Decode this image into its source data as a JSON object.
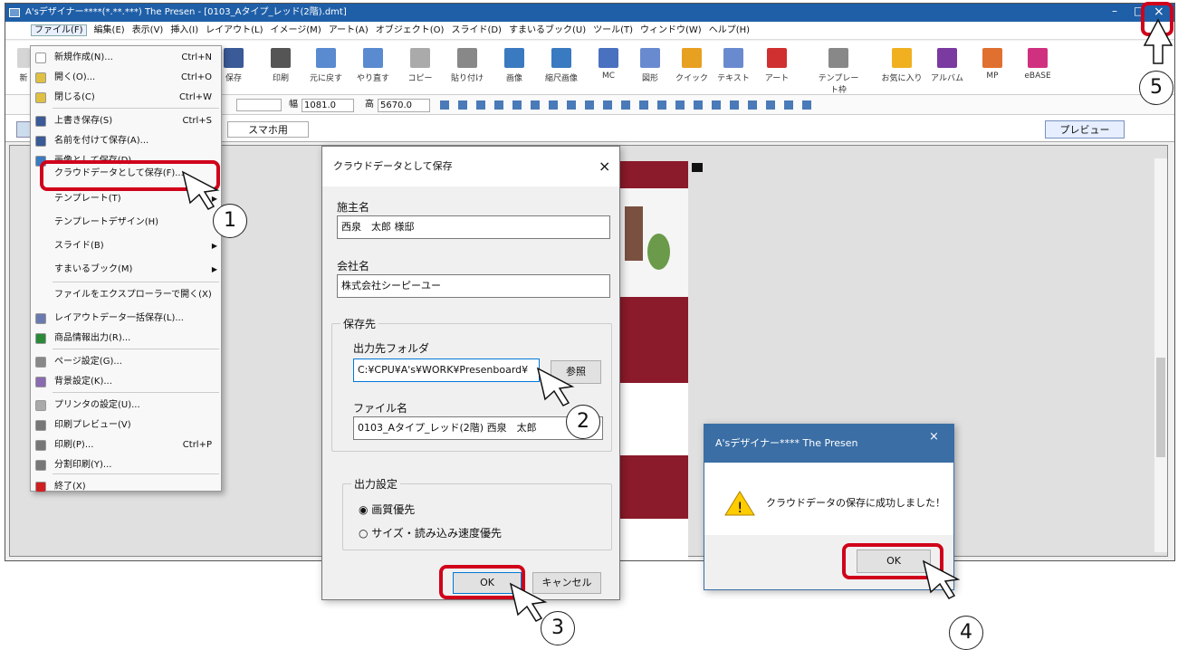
{
  "window": {
    "title": "A'sデザイナー****(*.**.***) The Presen - [0103_Aタイプ_レッド(2階).dmt]",
    "minimize": "–",
    "maximize": "□",
    "close": "×"
  },
  "menubar": [
    "ファイル(F)",
    "編集(E)",
    "表示(V)",
    "挿入(I)",
    "レイアウト(L)",
    "イメージ(M)",
    "アート(A)",
    "オブジェクト(O)",
    "スライド(D)",
    "すまいるブック(U)",
    "ツール(T)",
    "ウィンドウ(W)",
    "ヘルプ(H)"
  ],
  "toolbar": {
    "items": [
      "保存",
      "印刷",
      "元に戻す",
      "やり直す",
      "コピー",
      "貼り付け",
      "画像",
      "縮尺画像",
      "MC",
      "図形",
      "クイック",
      "テキスト",
      "アート",
      "テンプレート枠",
      "お気に入り",
      "アルバム",
      "MP",
      "eBASE"
    ],
    "new_label": "新"
  },
  "row2": {
    "width_label": "幅",
    "width_value": "1081.0",
    "height_label": "高",
    "height_value": "5670.0"
  },
  "row3": {
    "smartphone_tab": "スマホ用",
    "preview_button": "プレビュー"
  },
  "file_menu": [
    {
      "label": "新規作成(N)...",
      "shortcut": "Ctrl+N"
    },
    {
      "label": "開く(O)...",
      "shortcut": "Ctrl+O"
    },
    {
      "label": "閉じる(C)",
      "shortcut": "Ctrl+W"
    },
    {
      "label": "上書き保存(S)",
      "shortcut": "Ctrl+S"
    },
    {
      "label": "名前を付けて保存(A)...",
      "shortcut": ""
    },
    {
      "label": "画像として保存(D)...",
      "shortcut": ""
    },
    {
      "label": "クラウドデータとして保存(F)...",
      "shortcut": ""
    },
    {
      "label": "テンプレート(T)",
      "shortcut": ""
    },
    {
      "label": "テンプレートデザイン(H)",
      "shortcut": ""
    },
    {
      "label": "スライド(B)",
      "shortcut": ""
    },
    {
      "label": "すまいるブック(M)",
      "shortcut": ""
    },
    {
      "label": "ファイルをエクスプローラーで開く(X)",
      "shortcut": ""
    },
    {
      "label": "レイアウトデータ一括保存(L)...",
      "shortcut": ""
    },
    {
      "label": "商品情報出力(R)...",
      "shortcut": ""
    },
    {
      "label": "ページ設定(G)...",
      "shortcut": ""
    },
    {
      "label": "背景設定(K)...",
      "shortcut": ""
    },
    {
      "label": "プリンタの設定(U)...",
      "shortcut": ""
    },
    {
      "label": "印刷プレビュー(V)",
      "shortcut": ""
    },
    {
      "label": "印刷(P)...",
      "shortcut": "Ctrl+P"
    },
    {
      "label": "分割印刷(Y)...",
      "shortcut": ""
    },
    {
      "label": "終了(X)",
      "shortcut": ""
    }
  ],
  "cloud_dialog": {
    "title": "クラウドデータとして保存",
    "close": "×",
    "owner_label": "施主名",
    "owner_value": "西泉　太郎 様邸",
    "company_label": "会社名",
    "company_value": "株式会社シーピーユー",
    "save_group": "保存先",
    "folder_label": "出力先フォルダ",
    "folder_value": "C:¥CPU¥A's¥WORK¥Presenboard¥",
    "browse": "参照",
    "filename_label": "ファイル名",
    "filename_value": "0103_Aタイプ_レッド(2階) 西泉　太郎",
    "output_group": "出力設定",
    "option1": "画質優先",
    "option2": "サイズ・読み込み速度優先",
    "ok": "OK",
    "cancel": "キャンセル"
  },
  "success_dialog": {
    "title": "A'sデザイナー**** The Presen",
    "close": "×",
    "message": "クラウドデータの保存に成功しました！",
    "ok": "OK"
  },
  "steps": [
    "1",
    "2",
    "3",
    "4",
    "5"
  ],
  "colors": {
    "highlight": "#d0021b",
    "title_bar": "#1f5fa8",
    "preview_bg": "#8b1a2a"
  }
}
